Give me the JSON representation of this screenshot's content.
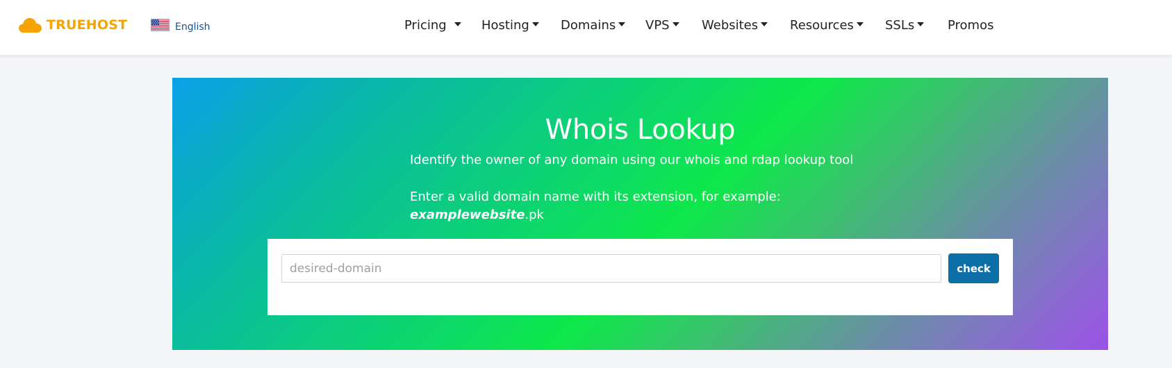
{
  "header": {
    "brand": "TRUEHOST",
    "language": "English",
    "nav": [
      {
        "label": "Pricing",
        "dropdown": true
      },
      {
        "label": "Hosting",
        "dropdown": true
      },
      {
        "label": "Domains",
        "dropdown": true
      },
      {
        "label": "VPS",
        "dropdown": true
      },
      {
        "label": "Websites",
        "dropdown": true
      },
      {
        "label": "Resources",
        "dropdown": true
      },
      {
        "label": "SSLs",
        "dropdown": true
      },
      {
        "label": "Promos",
        "dropdown": false
      }
    ]
  },
  "hero": {
    "title": "Whois Lookup",
    "subtitle": "Identify the owner of any domain using our whois and rdap lookup tool",
    "instruction": "Enter a valid domain name with its extension, for example:",
    "example_name": "examplewebsite",
    "example_ext": ".pk"
  },
  "search": {
    "placeholder": "desired-domain",
    "value": "",
    "button_label": "check"
  },
  "colors": {
    "brand": "#f5a300",
    "language_link": "#1d4f8c",
    "check_button": "#0d6fa8",
    "hero_gradient": [
      "#0aa0e8",
      "#0ee84a",
      "#9a52e6"
    ]
  },
  "icons": {
    "logo": "cloud-icon",
    "language_flag": "us-flag-icon",
    "dropdown": "caret-down-icon"
  }
}
